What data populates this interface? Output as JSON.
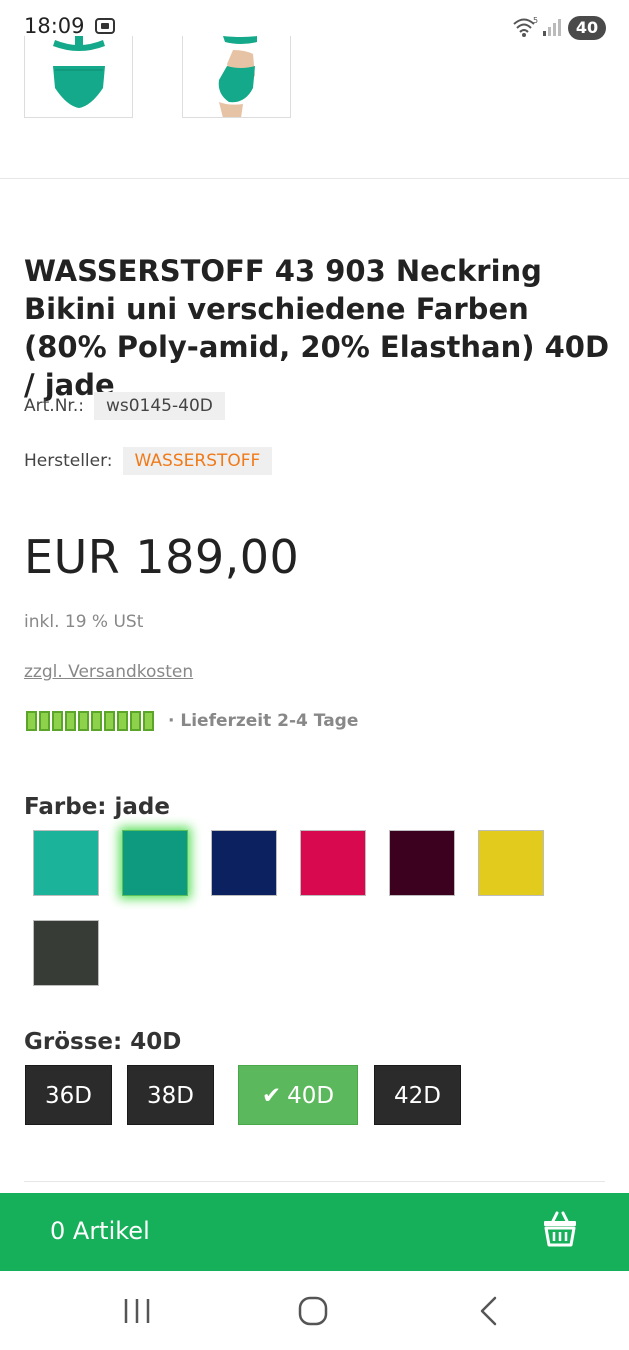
{
  "status_bar": {
    "time": "18:09",
    "battery": "40",
    "icons": [
      "screenshot-icon",
      "wifi-icon",
      "signal-icon",
      "battery-icon"
    ]
  },
  "product": {
    "title": "WASSERSTOFF 43 903 Neckring Bikini uni verschiedene Farben (80% Poly-amid, 20% Elasthan) 40D / jade",
    "art_nr_label": "Art.Nr.:",
    "art_nr_value": "ws0145-40D",
    "manufacturer_label": "Hersteller:",
    "manufacturer_value": "WASSERSTOFF",
    "price": "EUR 189,00",
    "tax_note": "inkl. 19 % USt",
    "shipping_link": "zzgl. Versandkosten",
    "delivery_time": "· Lieferzeit 2-4 Tage",
    "delivery_bars": 10
  },
  "color_selector": {
    "label": "Farbe: jade",
    "swatches": [
      {
        "name": "turquoise",
        "color": "#1bb39a",
        "selected": false
      },
      {
        "name": "jade",
        "color": "#0e9a7e",
        "selected": true
      },
      {
        "name": "navy",
        "color": "#0b2160",
        "selected": false
      },
      {
        "name": "pink",
        "color": "#d9094f",
        "selected": false
      },
      {
        "name": "aubergine",
        "color": "#3d0120",
        "selected": false
      },
      {
        "name": "yellow",
        "color": "#e3cb1e",
        "selected": false
      },
      {
        "name": "dark-olive",
        "color": "#373d36",
        "selected": false
      }
    ]
  },
  "size_selector": {
    "label": "Grösse: 40D",
    "sizes": [
      {
        "label": "36D",
        "active": false
      },
      {
        "label": "38D",
        "active": false
      },
      {
        "label": "40D",
        "active": true
      },
      {
        "label": "42D",
        "active": false
      }
    ]
  },
  "cart": {
    "count_label": "0 Artikel"
  },
  "colors": {
    "accent_green": "#16b05a",
    "active_size": "#5cb85c",
    "manufacturer_orange": "#f07a1a",
    "bikini_color": "#14a98a"
  }
}
